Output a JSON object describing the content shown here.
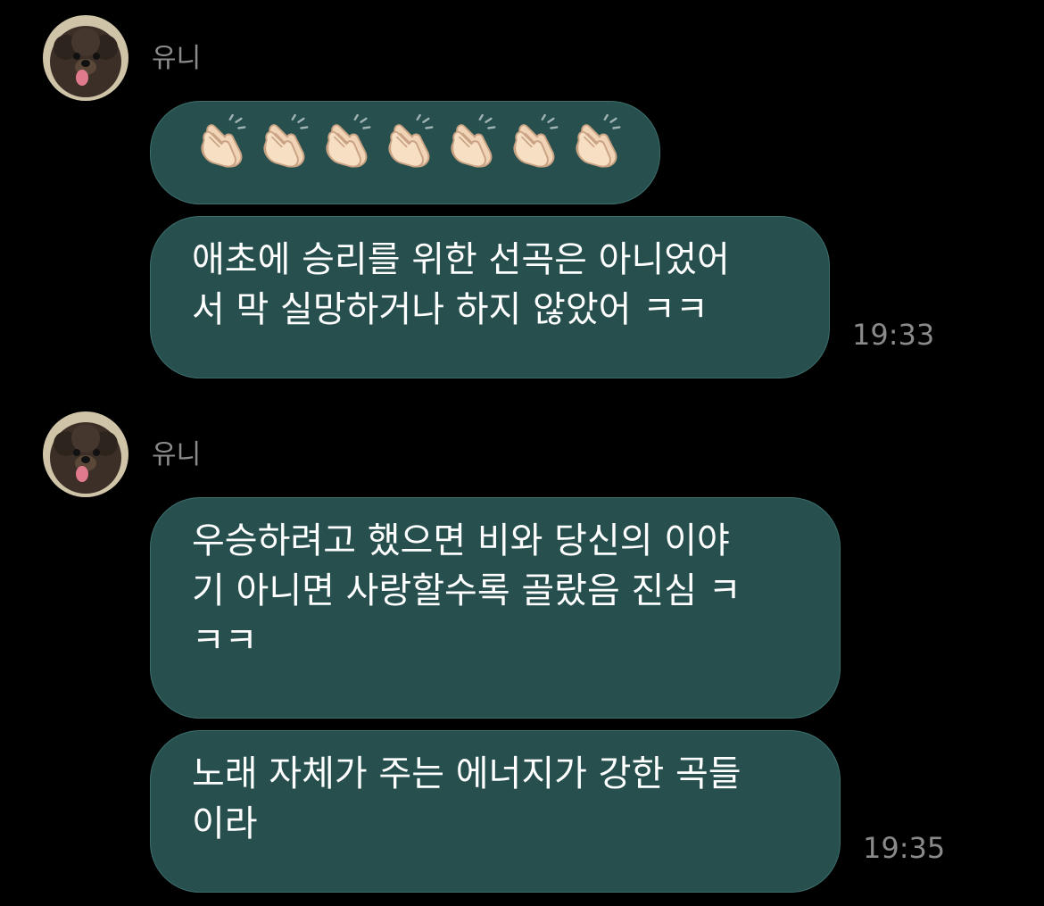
{
  "groups": [
    {
      "sender": "유니",
      "messages": [
        {
          "emoji": "👏",
          "emoji_count": 7,
          "emoji_icon": "clapping-hands-icon"
        },
        {
          "text": "애초에 승리를 위한 선곡은 아니었어\n서 막 실망하거나 하지 않았어 ㅋㅋ",
          "time": "19:33"
        }
      ]
    },
    {
      "sender": "유니",
      "messages": [
        {
          "text": "우승하려고 했으면 비와 당신의 이야\n기 아니면 사랑할수록 골랐음 진심 ㅋ\nㅋㅋ"
        },
        {
          "text": "노래 자체가 주는 에너지가 강한 곡들\n이라",
          "time": "19:35"
        }
      ]
    }
  ],
  "colors": {
    "background": "#000000",
    "bubble": "#264f4e",
    "bubble_border": "#3d6e6c",
    "text": "#ffffff",
    "meta": "#8a8a8a"
  }
}
